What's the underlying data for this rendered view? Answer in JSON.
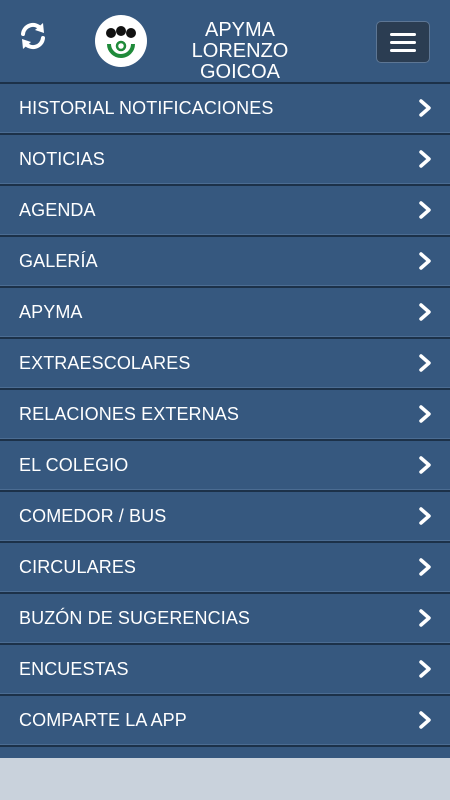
{
  "header": {
    "title_line1": "APYMA",
    "title_line2": "LORENZO GOICOA",
    "refresh_icon": "refresh-icon",
    "menu_icon": "hamburger-menu-icon"
  },
  "menu": {
    "items": [
      {
        "label": "HISTORIAL NOTIFICACIONES"
      },
      {
        "label": "NOTICIAS"
      },
      {
        "label": "AGENDA"
      },
      {
        "label": "GALERÍA"
      },
      {
        "label": "APYMA"
      },
      {
        "label": "EXTRAESCOLARES"
      },
      {
        "label": "RELACIONES EXTERNAS"
      },
      {
        "label": "EL COLEGIO"
      },
      {
        "label": "COMEDOR / BUS"
      },
      {
        "label": "CIRCULARES"
      },
      {
        "label": "BUZÓN DE SUGERENCIAS"
      },
      {
        "label": "ENCUESTAS"
      },
      {
        "label": "COMPARTE LA APP"
      }
    ]
  },
  "colors": {
    "primary": "#36587f",
    "divider": "#1c3149",
    "menu_button": "#2b3d52",
    "logo_green": "#1f8a3a"
  }
}
